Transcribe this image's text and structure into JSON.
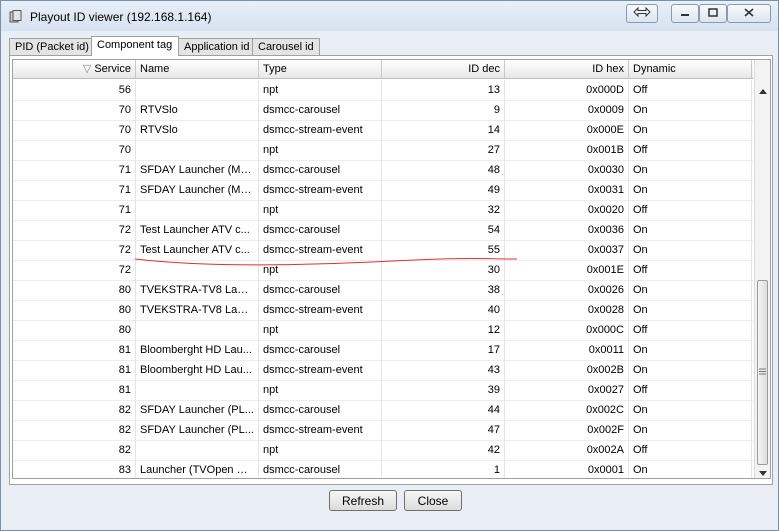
{
  "window": {
    "title": "Playout ID viewer (192.168.1.164)"
  },
  "tabs": [
    {
      "label": "PID (Packet id)"
    },
    {
      "label": "Component tag"
    },
    {
      "label": "Application id"
    },
    {
      "label": "Carousel id"
    }
  ],
  "table": {
    "sort_indicator": "▽",
    "headers": [
      "Service",
      "Name",
      "Type",
      "ID dec",
      "ID hex",
      "Dynamic"
    ],
    "rows": [
      {
        "service": "56",
        "name": "",
        "type": "npt",
        "id_dec": "13",
        "id_hex": "0x000D",
        "dynamic": "Off"
      },
      {
        "service": "70",
        "name": "RTVSlo",
        "type": "dsmcc-carousel",
        "id_dec": "9",
        "id_hex": "0x0009",
        "dynamic": "On"
      },
      {
        "service": "70",
        "name": "RTVSlo",
        "type": "dsmcc-stream-event",
        "id_dec": "14",
        "id_hex": "0x000E",
        "dynamic": "On"
      },
      {
        "service": "70",
        "name": "",
        "type": "npt",
        "id_dec": "27",
        "id_hex": "0x001B",
        "dynamic": "Off"
      },
      {
        "service": "71",
        "name": "SFDAY Launcher (MT...",
        "type": "dsmcc-carousel",
        "id_dec": "48",
        "id_hex": "0x0030",
        "dynamic": "On"
      },
      {
        "service": "71",
        "name": "SFDAY Launcher (MT...",
        "type": "dsmcc-stream-event",
        "id_dec": "49",
        "id_hex": "0x0031",
        "dynamic": "On"
      },
      {
        "service": "71",
        "name": "",
        "type": "npt",
        "id_dec": "32",
        "id_hex": "0x0020",
        "dynamic": "Off"
      },
      {
        "service": "72",
        "name": "Test Launcher ATV c...",
        "type": "dsmcc-carousel",
        "id_dec": "54",
        "id_hex": "0x0036",
        "dynamic": "On"
      },
      {
        "service": "72",
        "name": "Test Launcher ATV c...",
        "type": "dsmcc-stream-event",
        "id_dec": "55",
        "id_hex": "0x0037",
        "dynamic": "On"
      },
      {
        "service": "72",
        "name": "",
        "type": "npt",
        "id_dec": "30",
        "id_hex": "0x001E",
        "dynamic": "Off"
      },
      {
        "service": "80",
        "name": "TVEKSTRA-TV8 Laun...",
        "type": "dsmcc-carousel",
        "id_dec": "38",
        "id_hex": "0x0026",
        "dynamic": "On"
      },
      {
        "service": "80",
        "name": "TVEKSTRA-TV8 Laun...",
        "type": "dsmcc-stream-event",
        "id_dec": "40",
        "id_hex": "0x0028",
        "dynamic": "On"
      },
      {
        "service": "80",
        "name": "",
        "type": "npt",
        "id_dec": "12",
        "id_hex": "0x000C",
        "dynamic": "Off"
      },
      {
        "service": "81",
        "name": "Bloomberght HD Lau...",
        "type": "dsmcc-carousel",
        "id_dec": "17",
        "id_hex": "0x0011",
        "dynamic": "On"
      },
      {
        "service": "81",
        "name": "Bloomberght HD Lau...",
        "type": "dsmcc-stream-event",
        "id_dec": "43",
        "id_hex": "0x002B",
        "dynamic": "On"
      },
      {
        "service": "81",
        "name": "",
        "type": "npt",
        "id_dec": "39",
        "id_hex": "0x0027",
        "dynamic": "Off"
      },
      {
        "service": "82",
        "name": "SFDAY Launcher (PL...",
        "type": "dsmcc-carousel",
        "id_dec": "44",
        "id_hex": "0x002C",
        "dynamic": "On"
      },
      {
        "service": "82",
        "name": "SFDAY Launcher (PL...",
        "type": "dsmcc-stream-event",
        "id_dec": "47",
        "id_hex": "0x002F",
        "dynamic": "On"
      },
      {
        "service": "82",
        "name": "",
        "type": "npt",
        "id_dec": "42",
        "id_hex": "0x002A",
        "dynamic": "Off"
      },
      {
        "service": "83",
        "name": "Launcher (TVOpen HD)",
        "type": "dsmcc-carousel",
        "id_dec": "1",
        "id_hex": "0x0001",
        "dynamic": "On"
      }
    ]
  },
  "buttons": {
    "refresh": "Refresh",
    "close": "Close"
  },
  "colors": {
    "annotation_line": "#e03030",
    "window_frame": "#7a8fa8"
  }
}
